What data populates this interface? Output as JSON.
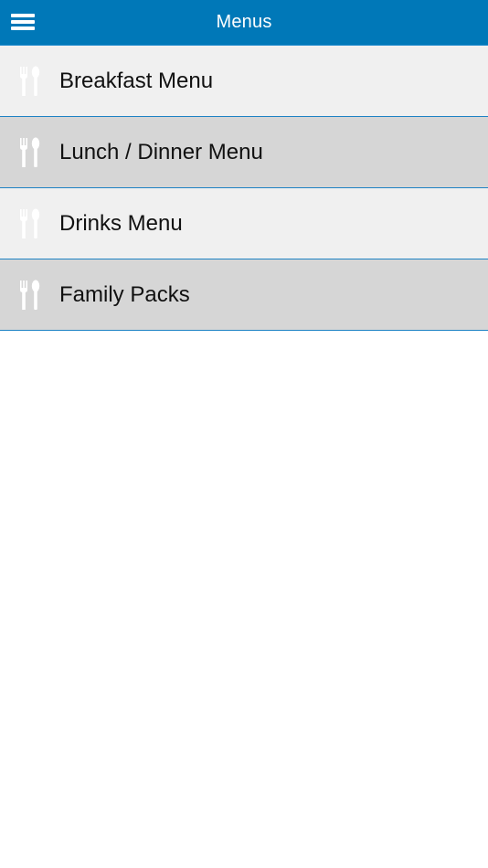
{
  "header": {
    "title": "Menus",
    "menu_icon": "hamburger-icon",
    "background_color": "#0078b8"
  },
  "menu": {
    "items": [
      {
        "label": "Breakfast Menu",
        "icon": "fork-spoon-icon"
      },
      {
        "label": "Lunch / Dinner Menu",
        "icon": "fork-spoon-icon"
      },
      {
        "label": "Drinks Menu",
        "icon": "fork-spoon-icon"
      },
      {
        "label": "Family Packs",
        "icon": "fork-spoon-icon"
      }
    ],
    "divider_color": "#1d82c4",
    "row_colors": [
      "#f0f0f0",
      "#d6d6d6"
    ]
  }
}
